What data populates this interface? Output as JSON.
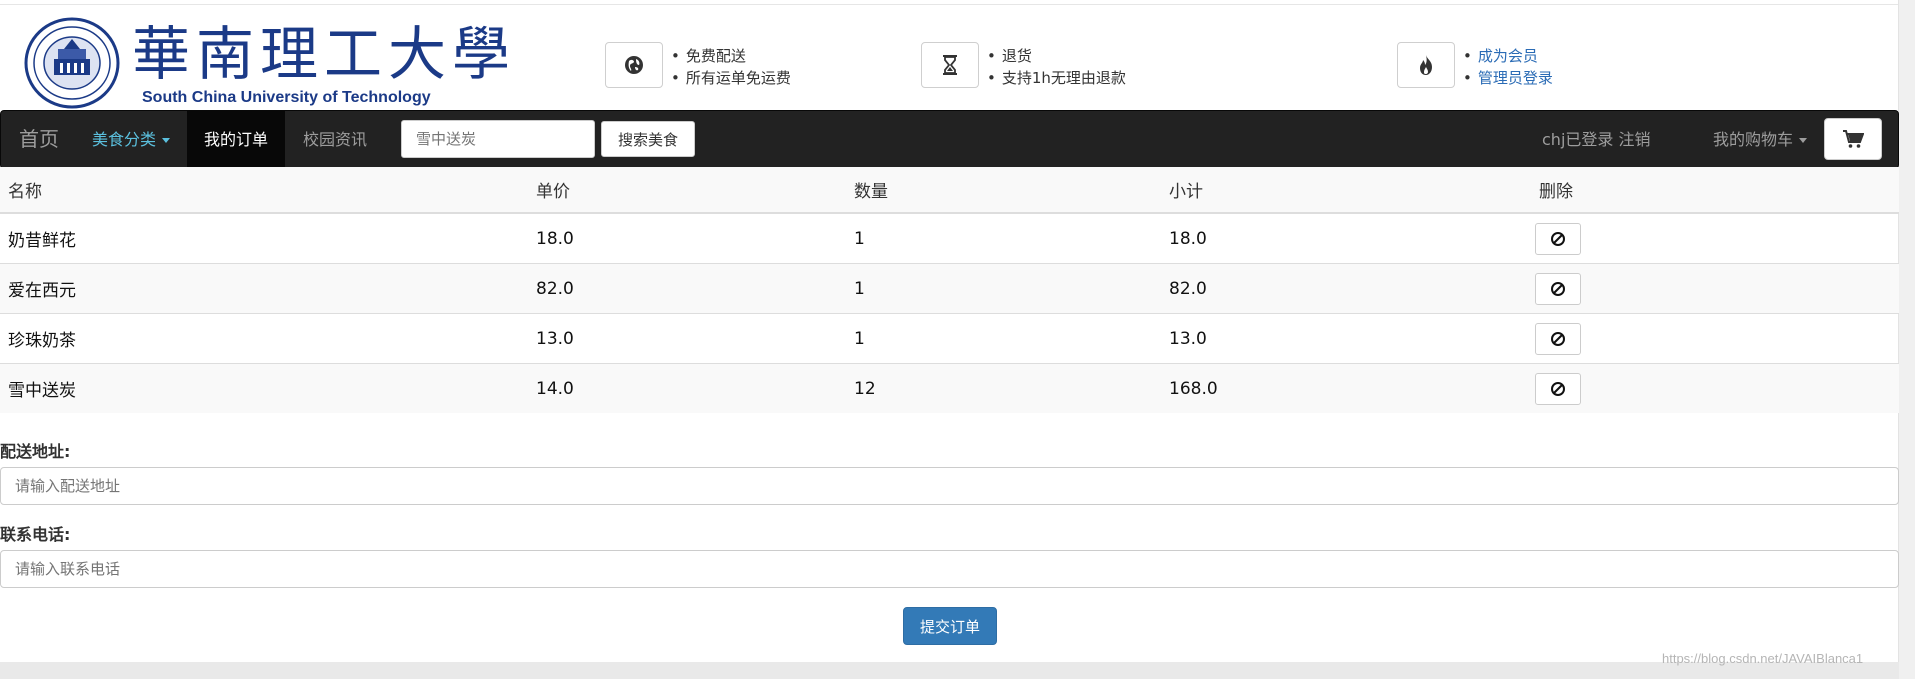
{
  "header": {
    "logo_cn": "華南理工大學",
    "logo_en": "South China University of Technology",
    "features": [
      {
        "icon": "globe-icon",
        "items": [
          "免费配送",
          "所有运单免运费"
        ]
      },
      {
        "icon": "hourglass-icon",
        "items": [
          "退货",
          "支持1h无理由退款"
        ]
      },
      {
        "icon": "fire-icon",
        "items": [
          "成为会员",
          "管理员登录"
        ]
      }
    ]
  },
  "navbar": {
    "brand": "首页",
    "category": "美食分类",
    "orders": "我的订单",
    "news": "校园资讯",
    "search_placeholder": "雪中送炭",
    "search_button": "搜索美食",
    "user_status": "chj已登录 注销",
    "cart_menu": "我的购物车",
    "cart_icon": "shopping-cart-icon"
  },
  "table": {
    "headers": [
      "名称",
      "单价",
      "数量",
      "小计",
      "删除"
    ],
    "rows": [
      {
        "name": "奶昔鲜花",
        "price": "18.0",
        "qty": "1",
        "subtotal": "18.0"
      },
      {
        "name": "爱在西元",
        "price": "82.0",
        "qty": "1",
        "subtotal": "82.0"
      },
      {
        "name": "珍珠奶茶",
        "price": "13.0",
        "qty": "1",
        "subtotal": "13.0"
      },
      {
        "name": "雪中送炭",
        "price": "14.0",
        "qty": "12",
        "subtotal": "168.0"
      }
    ],
    "delete_icon": "ban-icon"
  },
  "form": {
    "address_label": "配送地址:",
    "address_placeholder": "请输入配送地址",
    "phone_label": "联系电话:",
    "phone_placeholder": "请输入联系电话",
    "submit": "提交订单"
  },
  "watermark": "https://blog.csdn.net/JAVAIBlanca1",
  "colors": {
    "navbar_bg": "#222222",
    "link": "#2a6bb5",
    "primary_button": "#337ab7",
    "logo": "#1b3a87"
  }
}
